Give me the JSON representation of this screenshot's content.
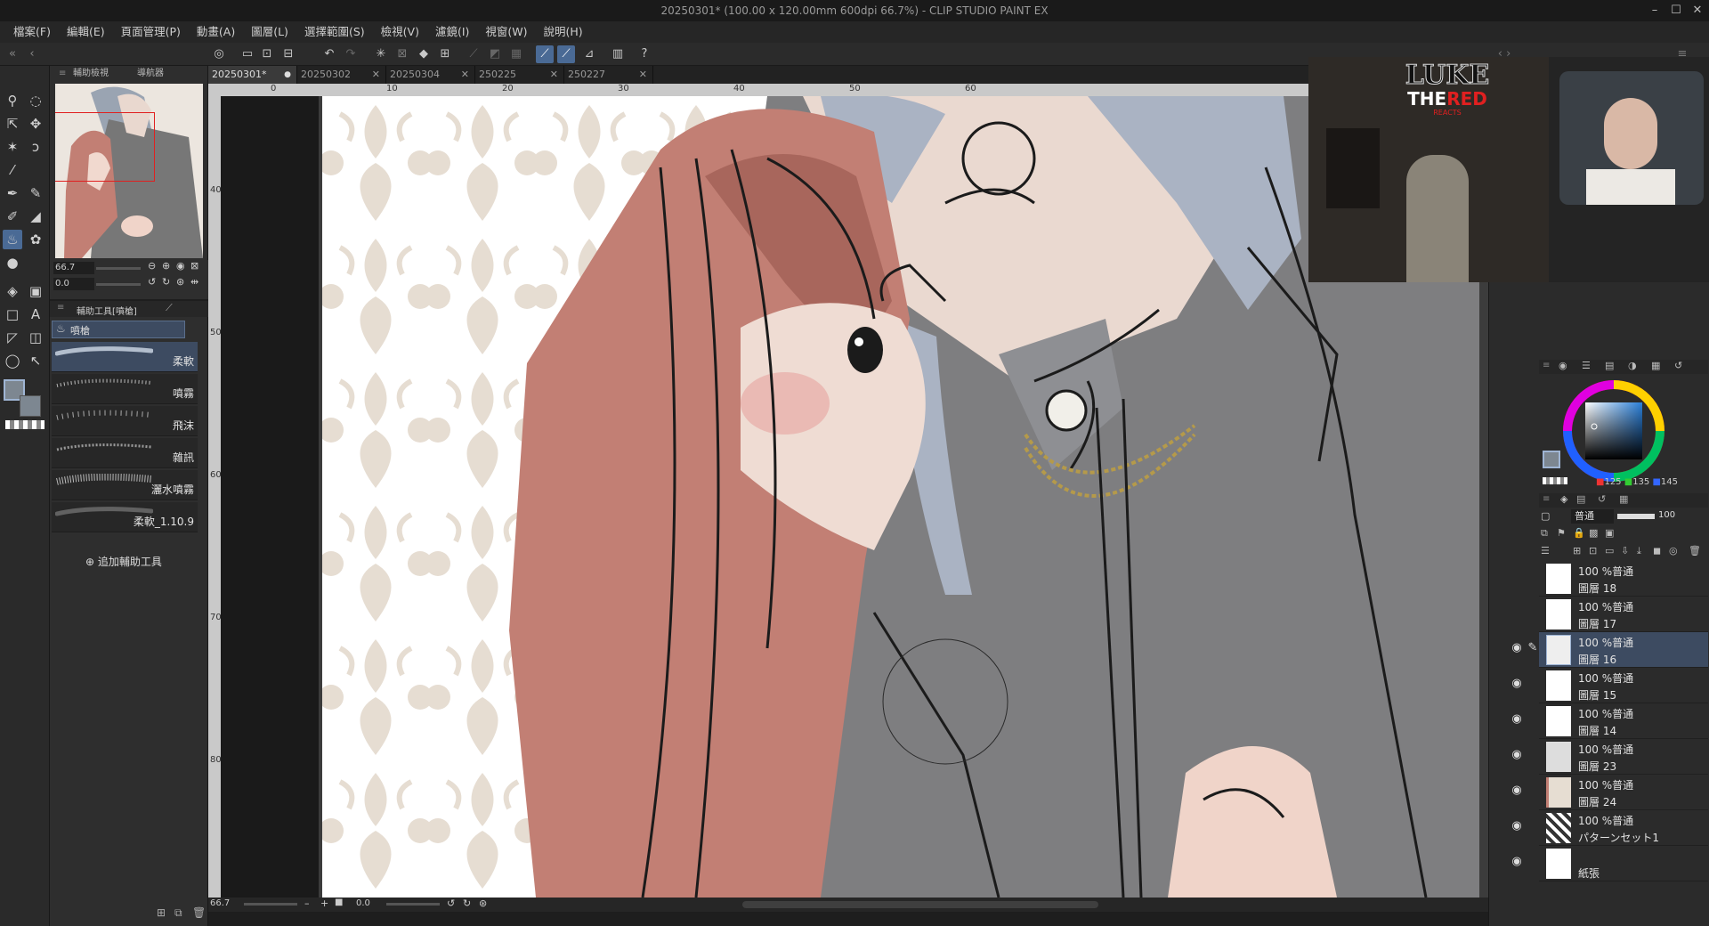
{
  "titlebar": {
    "title": "20250301* (100.00 x 120.00mm 600dpi 66.7%)  - CLIP STUDIO PAINT EX"
  },
  "menu": [
    "檔案(F)",
    "編輯(E)",
    "頁面管理(P)",
    "動畫(A)",
    "圖層(L)",
    "選擇範圍(S)",
    "檢視(V)",
    "濾鏡(I)",
    "視窗(W)",
    "說明(H)"
  ],
  "nav": {
    "tab_sub": "輔助檢視",
    "tab_nav": "導航器",
    "zoom": "66.7",
    "angle": "0.0"
  },
  "subtool": {
    "header": "輔助工具[噴槍]",
    "group": "噴槍",
    "add_label": "追加輔助工具",
    "brushes": [
      "柔軟",
      "噴霧",
      "飛沫",
      "雜訊",
      "灑水噴霧",
      "柔軟_1.10.9"
    ]
  },
  "tabs": [
    "20250301*",
    "20250302",
    "20250304",
    "250225",
    "250227"
  ],
  "ruler": {
    "h": [
      "0",
      "10",
      "20",
      "30",
      "40",
      "50",
      "60"
    ],
    "v": [
      "40",
      "50",
      "60",
      "70",
      "80"
    ]
  },
  "status": {
    "zoom": "66.7",
    "angle": "0.0"
  },
  "color": {
    "r": "125",
    "g": "135",
    "b": "145"
  },
  "layerprops": {
    "blend": "普通",
    "opacity": "100"
  },
  "layers": [
    {
      "pct": "100 %普通",
      "name": "圖層 18"
    },
    {
      "pct": "100 %普通",
      "name": "圖層 17"
    },
    {
      "pct": "100 %普通",
      "name": "圖層 16"
    },
    {
      "pct": "100 %普通",
      "name": "圖層 15"
    },
    {
      "pct": "100 %普通",
      "name": "圖層 14"
    },
    {
      "pct": "100 %普通",
      "name": "圖層 23"
    },
    {
      "pct": "100 %普通",
      "name": "圖層 24"
    },
    {
      "pct": "100 %普通",
      "name": "パターンセット1"
    },
    {
      "pct": "",
      "name": "紙張"
    }
  ],
  "overlay": {
    "logo_top": "LUKE",
    "logo_the": "THE",
    "logo_red": "RED",
    "logo_sub": "REACTS"
  },
  "colors": {
    "accent": "#4a6a95",
    "bg": "#2b2b2b",
    "shirt": "#7e7e80",
    "hair": "#b87468",
    "wallpaper": "#e6ddd2"
  }
}
